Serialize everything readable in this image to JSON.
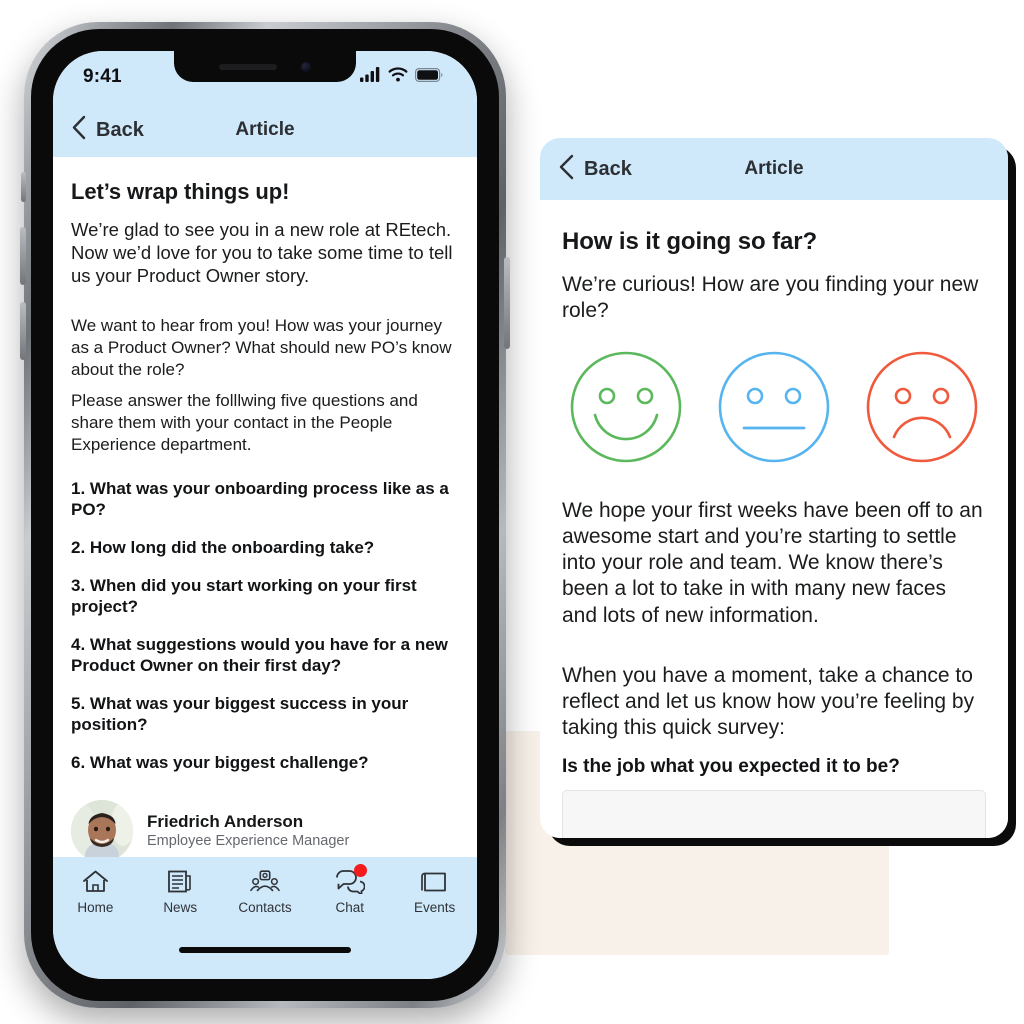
{
  "phone1": {
    "statusbar": {
      "time": "9:41",
      "signal_icon": "cellular-signal-icon",
      "wifi_icon": "wifi-icon",
      "battery_icon": "battery-icon"
    },
    "navbar": {
      "back_label": "Back",
      "title": "Article",
      "back_icon": "chevron-left-icon"
    },
    "article": {
      "headline": "Let’s wrap things up!",
      "intro": "We’re glad to see you in a new role at REtech. Now we’d love for you to take some time to tell us your Product Owner story.",
      "paragraph_1": "We want to hear from you! How was your journey as a Product Owner? What should new PO’s know about the role?",
      "paragraph_2": "Please answer the folllwing five questions and share them with your contact in the People Experience department.",
      "questions": [
        "1. What was your onboarding process like as a PO?",
        "2. How long did the onboarding take?",
        "3. When did you start working on your first project?",
        "4. What suggestions would you have for a new Product Owner on their first day?",
        "5. What was your biggest success in your position?",
        "6. What was your biggest challenge?"
      ],
      "author": {
        "name": "Friedrich Anderson",
        "role": "Employee Experience Manager",
        "avatar_icon": "user-photo-avatar"
      }
    },
    "tabbar": {
      "items": [
        {
          "label": "Home",
          "icon": "home-icon",
          "badge": false
        },
        {
          "label": "News",
          "icon": "news-icon",
          "badge": false
        },
        {
          "label": "Contacts",
          "icon": "contacts-icon",
          "badge": false
        },
        {
          "label": "Chat",
          "icon": "chat-icon",
          "badge": true
        },
        {
          "label": "Events",
          "icon": "events-folder-icon",
          "badge": false
        }
      ]
    }
  },
  "phone2": {
    "navbar": {
      "back_label": "Back",
      "title": "Article",
      "back_icon": "chevron-left-icon"
    },
    "article": {
      "headline": "How is it going so far?",
      "intro": "We’re curious! How are you finding your new role?",
      "paragraph_1": "We hope your first weeks have been off to an awesome start and you’re starting to settle into your role and team. We know there’s been a lot to take in with many new faces and lots of new information.",
      "paragraph_2": "When you have a moment, take a chance to reflect and let us know how you’re feeling by taking this quick survey:",
      "faces": [
        {
          "name": "happy-face-icon",
          "mood": "happy",
          "color": "#5CB85C"
        },
        {
          "name": "neutral-face-icon",
          "mood": "neutral",
          "color": "#56B4EF"
        },
        {
          "name": "sad-face-icon",
          "mood": "sad",
          "color": "#F0593C"
        }
      ],
      "survey": {
        "question": "Is the job what you expected it to be?",
        "answer_value": "",
        "answer_placeholder": ""
      }
    }
  },
  "theme": {
    "accent_blue": "#cfe9fb",
    "cream": "#f8f1e9",
    "text_dark": "#16181a",
    "text_muted": "#65696e",
    "badge_red": "#f31b1b"
  }
}
